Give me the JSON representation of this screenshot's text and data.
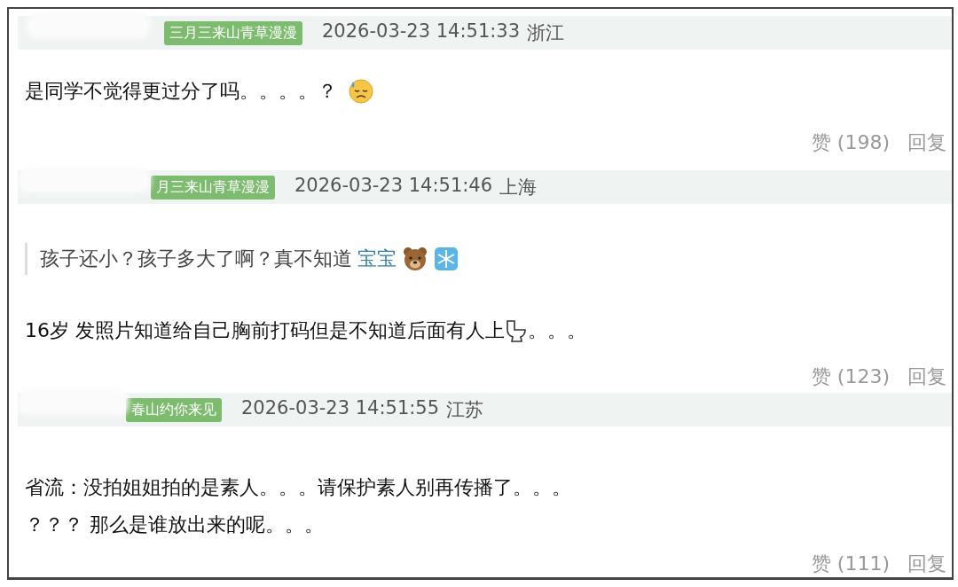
{
  "comments": [
    {
      "badge": "三月三来山青草漫漫",
      "time": "2026-03-23 14:51:33",
      "location": "浙江",
      "body": [
        [
          {
            "kind": "text",
            "text": "是同学不觉得更过分了吗。。。。？"
          },
          {
            "kind": "sweat-face"
          }
        ]
      ],
      "likes": "赞 (198)",
      "reply": "回复"
    },
    {
      "badge": "月三来山青草漫漫",
      "time": "2026-03-23 14:51:46",
      "location": "上海",
      "quote": [
        {
          "kind": "text",
          "text": "孩子还小？孩子多大了啊？真不知道"
        },
        {
          "kind": "link",
          "text": "宝宝"
        },
        {
          "kind": "bear"
        },
        {
          "kind": "snowflake"
        }
      ],
      "body": [
        [
          {
            "kind": "text",
            "text": "16岁 发照片知道给自己胸前打码但是不知道后面有人上"
          },
          {
            "kind": "toilet"
          },
          {
            "kind": "text",
            "text": "。。。"
          }
        ]
      ],
      "likes": "赞 (123)",
      "reply": "回复"
    },
    {
      "badge": "春山约你来见",
      "time": "2026-03-23 14:51:55",
      "location": "江苏",
      "body": [
        [
          {
            "kind": "text",
            "text": "省流：没拍姐姐拍的是素人。。。请保护素人别再传播了。。。"
          }
        ],
        [
          {
            "kind": "text",
            "text": "？？？ 那么是谁放出来的呢。。。"
          }
        ]
      ],
      "likes": "赞 (111)",
      "reply": "回复"
    }
  ]
}
